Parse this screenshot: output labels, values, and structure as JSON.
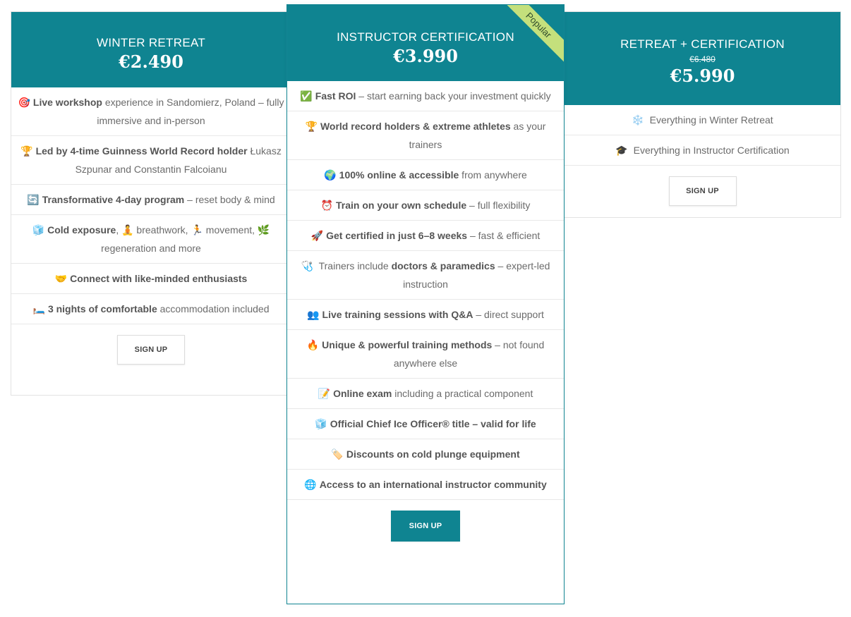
{
  "cards": {
    "winter": {
      "title": "WINTER RETREAT",
      "price": "€2.490",
      "features": [
        {
          "icon": "🎯",
          "bold": "Live workshop",
          "text": " experience in Sandomierz, Poland – fully immersive and in-person"
        },
        {
          "icon": "🏆",
          "bold": "Led by 4-time Guinness World Record holder",
          "text": " Łukasz Szpunar and Constantin Falcoianu"
        },
        {
          "icon": "🔄",
          "bold": "Transformative 4-day program",
          "text": " – reset body & mind"
        },
        {
          "icon": "🧊",
          "bold": "Cold exposure",
          "text": ", 🧘 breathwork, 🏃 movement, 🌿 regeneration and more"
        },
        {
          "icon": "🤝",
          "bold": "Connect with like-minded  enthusiasts",
          "text": ""
        },
        {
          "icon": "🛏️",
          "bold": "3 nights of comfortable",
          "text": " accommodation included"
        }
      ],
      "button": "SIGN UP"
    },
    "instructor": {
      "title": "INSTRUCTOR CERTIFICATION",
      "price": "€3.990",
      "ribbon": "Popular",
      "features": [
        {
          "icon": "✅",
          "bold": "Fast ROI",
          "text": " – start earning back your investment quickly"
        },
        {
          "icon": "🏆",
          "bold": "World record holders & extreme athletes",
          "text": " as your trainers"
        },
        {
          "icon": "🌍",
          "bold": "100% online & accessible",
          "text": " from anywhere"
        },
        {
          "icon": "⏰",
          "bold": "Train on your own schedule",
          "text": " – full flexibility"
        },
        {
          "icon": "🚀",
          "bold": "Get certified in just 6–8 weeks",
          "text": " – fast & efficient"
        },
        {
          "icon": "🩺",
          "pre": " Trainers include ",
          "bold": "doctors & paramedics",
          "text": " – expert-led instruction"
        },
        {
          "icon": "👥",
          "bold": "Live training sessions with Q&A",
          "text": " – direct support"
        },
        {
          "icon": "🔥",
          "bold": "Unique & powerful training methods",
          "text": " – not found anywhere else"
        },
        {
          "icon": "📝",
          "bold": "Online exam",
          "text": " including a practical component"
        },
        {
          "icon": "🧊",
          "bold": "Official Chief Ice Officer® title – valid for life",
          "text": ""
        },
        {
          "icon": "🏷️",
          "bold": "Discounts on cold plunge equipment",
          "text": ""
        },
        {
          "icon": "🌐",
          "bold": "Access to an international instructor community",
          "text": ""
        }
      ],
      "button": "SIGN UP"
    },
    "combo": {
      "title": "RETREAT + CERTIFICATION",
      "old_price": "€6.480",
      "price": "€5.990",
      "features": [
        {
          "icon": "❄️",
          "bold": "",
          "text": " Everything in Winter Retreat"
        },
        {
          "icon": "🎓",
          "bold": "",
          "text": " Everything in Instructor Certification"
        }
      ],
      "button": "SIGN UP"
    }
  },
  "colors": {
    "brand": "#0f8491",
    "ribbon": "#c4e07c"
  }
}
